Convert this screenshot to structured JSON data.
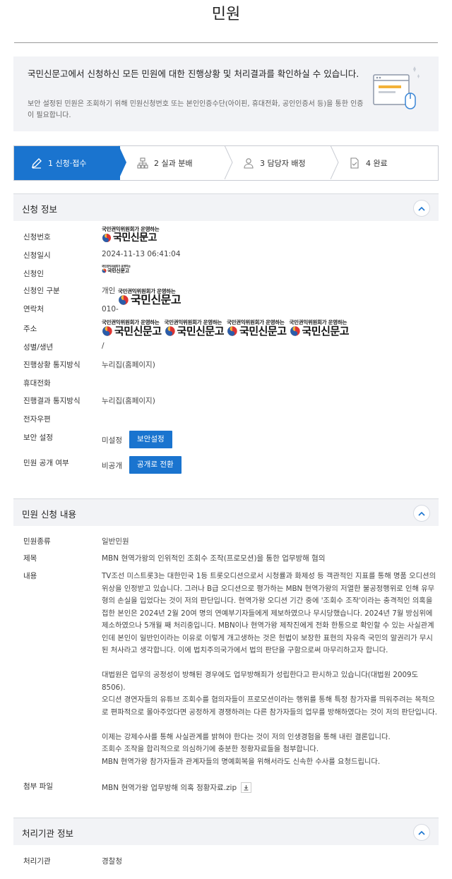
{
  "page_title": "민원",
  "intro": {
    "heading": "국민신문고에서 신청하신 모든 민원에 대한 진행상황 및 처리결과를 확인하실 수 있습니다.",
    "desc": "보안 설정된 민원은 조회하기 위해 민원신청번호 또는 본인인증수단(아이핀, 휴대전화, 공인인증서 등)을 통한 인증이 필요합니다."
  },
  "steps": [
    {
      "label": "1 신청·접수",
      "active": true,
      "icon": "pencil-icon"
    },
    {
      "label": "2 실과 분배",
      "active": false,
      "icon": "org-chart-icon"
    },
    {
      "label": "3 담당자 배정",
      "active": false,
      "icon": "person-icon"
    },
    {
      "label": "4 완료",
      "active": false,
      "icon": "document-check-icon"
    }
  ],
  "application_info": {
    "section_title": "신청 정보",
    "logo_caption": "국민권익위원회가 운영하는",
    "logo_name": "국민신문고",
    "rows": {
      "number_label": "신청번호",
      "date_label": "신청일시",
      "date_value": "2024-11-13 06:41:04",
      "applicant_label": "신청인",
      "type_label": "신청인 구분",
      "type_value": "개인",
      "contact_label": "연락처",
      "contact_prefix": "010-",
      "address_label": "주소",
      "gender_label": "성별/생년",
      "gender_value": "/",
      "notify_label": "진행상황 통지방식",
      "notify_value": "누리집(홈페이지)",
      "phone_label": "휴대전화",
      "result_label": "진행결과 통지방식",
      "result_value": "누리집(홈페이지)",
      "email_label": "전자우편",
      "security_label": "보안 설정",
      "security_value": "미설정",
      "security_button": "보안설정",
      "public_label": "민원 공개 여부",
      "public_value": "비공개",
      "public_button": "공개로 전환"
    }
  },
  "complaint": {
    "section_title": "민원 신청 내용",
    "kind_label": "민원종류",
    "kind_value": "일반민원",
    "subject_label": "제목",
    "subject_value": "MBN 현역가왕의 인위적인 조회수 조작(프로모션)을 통한 업무방해 혐의",
    "content_label": "내용",
    "content_value": "TV조선 미스트롯3는 대한민국 1등 트롯오디션으로서 시청률과 화제성 등 객관적인 지표를 통해 명품 오디션의 위상을 인정받고 있습니다. 그러나 B급 오디션으로 평가하는 MBN 현역가왕의 저열한 불공정행위로 인해 유무형의 손실을 입었다는 것이 저의 판단입니다. 현역가왕 오디션 기간 중에 '조회수 조작'이라는 충격적인 의혹을 접한 본인은 2024년 2월 20여 명의 연예부기자들에게 제보하였으나 무시당했습니다. 2024년 7월 방심위에 제소하였으나 5개월 째 처리중입니다. MBN이나 현역가왕 제작진에게 전화 한통으로 확인할 수 있는 사실관계인데 본인이 일반인이라는 이유로 이렇게 개고생하는 것은 헌법이 보장한 표현의 자유즉 국민의 알권리가 무시된 처사라고 생각합니다. 이에 법치주의국가에서 법의 판단을 구함으로써 마무리하고자 합니다.\n\n대법원은 업무의 공정성이 방해된 경우에도 업무방해죄가 성립한다고 판시하고 있습니다(대법원 2009도8506).\n오디션 경연자들의 유튜브 조회수를 협의자들이 프로모션이라는 행위를 통해 특정 참가자를 띄워주려는 목적으로 편파적으로 몰아주었다면 공정하게 경쟁하려는 다른 참가자들의 업무를 방해하였다는 것이 저의 판단입니다.\n\n이제는 강제수사를 통해 사실관계를 밝혀야 한다는 것이 저의 인생경험을 통해 내린 결론입니다.\n조회수 조작을 합리적으로 의심하기에 충분한 정황자료들을 첨부합니다.\nMBN 현역가왕 참가자들과 관계자들의 명예회복을 위해서라도 신속한 수사를 요청드립니다.",
    "attach_label": "첨부 파일",
    "attach_value": "MBN 현역가왕 업무방해 의혹 정황자료.zip"
  },
  "agency": {
    "section_title": "처리기관 정보",
    "agency_label": "처리기관",
    "agency_value": "경찰청"
  },
  "colors": {
    "accent": "#1a74cf",
    "panel": "#f2f3f6"
  }
}
